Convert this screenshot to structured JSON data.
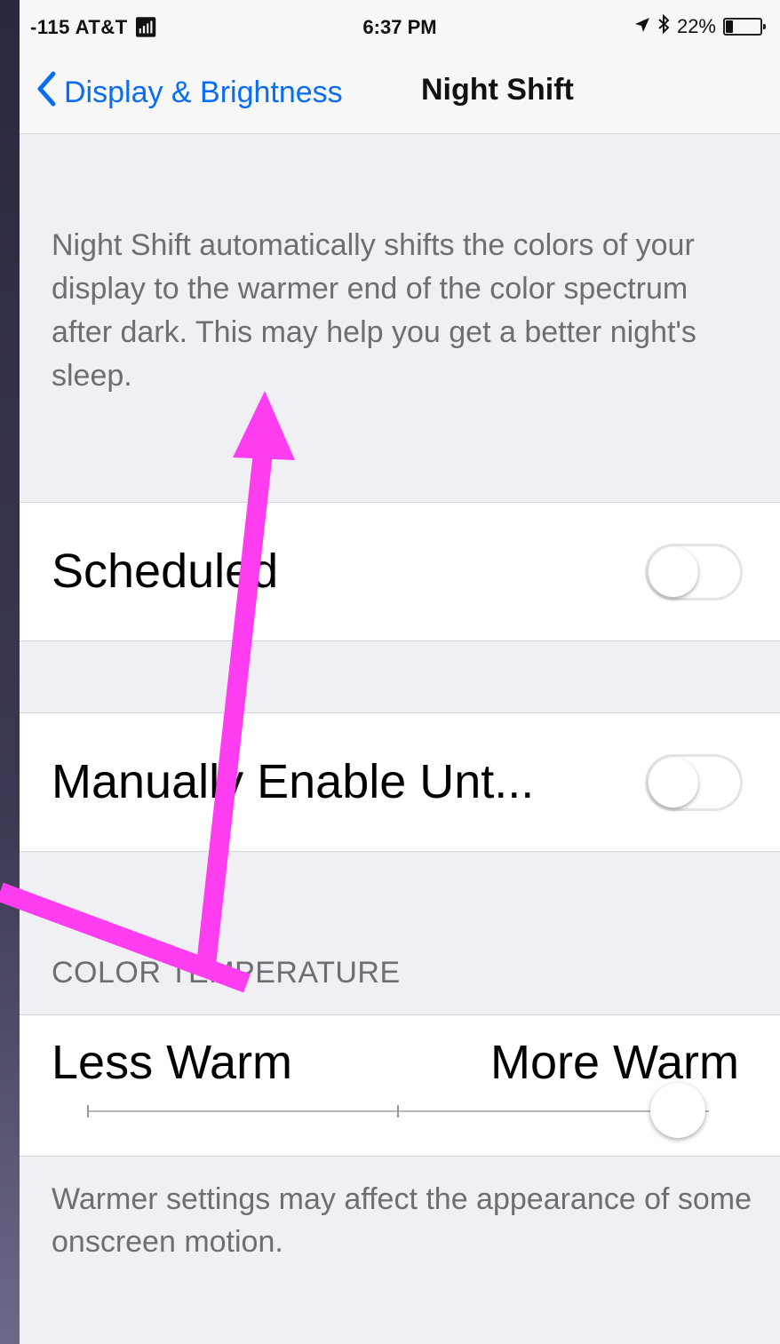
{
  "status_bar": {
    "carrier": "-115 AT&T",
    "time": "6:37 PM",
    "battery": "22%",
    "battery_level": 0.22
  },
  "nav": {
    "back_label": "Display & Brightness",
    "title": "Night Shift"
  },
  "description": "Night Shift automatically shifts the colors of your display to the warmer end of the color spectrum after dark. This may help you get a better night's sleep.",
  "scheduled": {
    "label": "Scheduled",
    "on": false
  },
  "manual": {
    "label": "Manually Enable Unt...",
    "on": false
  },
  "color_temperature": {
    "header": "COLOR TEMPERATURE",
    "less_label": "Less Warm",
    "more_label": "More Warm",
    "value": 0.95
  },
  "footer_note": "Warmer settings may affect the appearance of some onscreen motion.",
  "colors": {
    "link": "#0a6cf5",
    "annotation": "#ff3df0",
    "background": "#efeff4"
  }
}
